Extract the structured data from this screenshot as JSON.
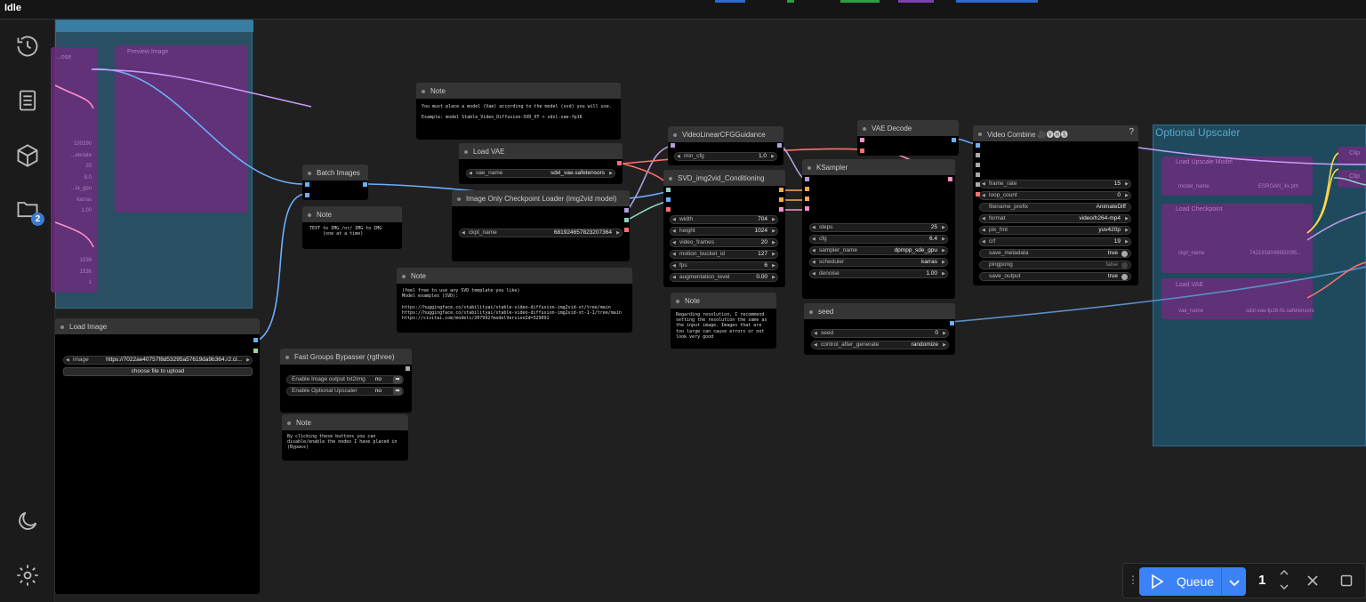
{
  "status": "Idle",
  "sidebar": {
    "queue_badge": "2"
  },
  "groups": {
    "optional_upscaler": "Optional Upscaler"
  },
  "left_group": {
    "preview_title": "Preview Image",
    "title_fragment": "...ose",
    "values": [
      "100290",
      "...elerate",
      "25",
      "8.0",
      "...la_gpu",
      "karras",
      "1.00"
    ],
    "bottom_values": [
      "1536",
      "1536",
      "1"
    ]
  },
  "nodes": {
    "load_image": {
      "title": "Load Image",
      "image_label": "image",
      "image_value": "https://7022ae40757f8d53295a57619da9b364.r2.cl...",
      "upload": "choose file to upload"
    },
    "batch_images": {
      "title": "Batch Images"
    },
    "note_txt2img": {
      "title": "Note",
      "text": "TEXT to IMG /or/ IMG to IMG\n     (one at a time)"
    },
    "fast_groups": {
      "title": "Fast Groups Bypasser (rgthree)",
      "items": [
        {
          "label": "Enable Image output txt2img",
          "value": "no"
        },
        {
          "label": "Enable Optional Upscaler",
          "value": "no"
        }
      ]
    },
    "note_bypass": {
      "title": "Note",
      "text": "By clicking these buttons you can\ndisable/enable the nodes I have placed in\n(Bypass)"
    },
    "note_vae": {
      "title": "Note",
      "text": "You must place a model (Vae) according to the model (svd) you will use.\n\nExample: model Stable_Video_Diffusion-SVD_XT > sdxl-vae-fp16"
    },
    "load_vae": {
      "title": "Load VAE",
      "label": "vae_name",
      "value": "sdxl_vae.safetensors"
    },
    "checkpoint": {
      "title": "Image Only Checkpoint Loader (img2vid model)",
      "label": "ckpt_name",
      "value": "681924657823207364"
    },
    "note_links": {
      "title": "Note",
      "text": "(feel free to use any SVD template you like)\nModel examples (SVD):\n\nhttps://huggingface.co/stabilityai/stable-video-diffusion-img2vid-xt/tree/main\nhttps://huggingface.co/stabilityai/stable-video-diffusion-img2vid-xt-1-1/tree/main\nhttps://civitai.com/models/207992?modelVersionId=329091"
    },
    "vlcfg": {
      "title": "VideoLinearCFGGuidance",
      "label": "min_cfg",
      "value": "1.0"
    },
    "svd_cond": {
      "title": "SVD_img2vid_Conditioning",
      "widgets": [
        {
          "label": "width",
          "value": "704"
        },
        {
          "label": "height",
          "value": "1024"
        },
        {
          "label": "video_frames",
          "value": "20"
        },
        {
          "label": "motion_bucket_id",
          "value": "127"
        },
        {
          "label": "fps",
          "value": "6"
        },
        {
          "label": "augmentation_level",
          "value": "0.00"
        }
      ]
    },
    "note_res": {
      "title": "Note",
      "text": "Regarding resolution, I recommend\nsetting the resolution the same as\nthe input image. Images that are\ntoo large can cause errors or not\nlook very good"
    },
    "vae_decode": {
      "title": "VAE Decode"
    },
    "ksampler": {
      "title": "KSampler",
      "widgets": [
        {
          "label": "steps",
          "value": "25"
        },
        {
          "label": "cfg",
          "value": "6.4"
        },
        {
          "label": "sampler_name",
          "value": "dpmpp_sde_gpu"
        },
        {
          "label": "scheduler",
          "value": "karras"
        },
        {
          "label": "denoise",
          "value": "1.00"
        }
      ]
    },
    "seed": {
      "title": "seed",
      "widgets": [
        {
          "label": "seed",
          "value": "0"
        },
        {
          "label": "control_after_generate",
          "value": "randomize"
        }
      ]
    },
    "video_combine": {
      "title": "Video Combine 🎥🅥🅗🅢",
      "help": "?",
      "widgets": [
        {
          "label": "frame_rate",
          "value": "15"
        },
        {
          "label": "loop_count",
          "value": "0"
        },
        {
          "label": "filename_prefix",
          "value": "AnimateDiff"
        },
        {
          "label": "format",
          "value": "video/h264-mp4"
        },
        {
          "label": "pix_fmt",
          "value": "yuv420p"
        },
        {
          "label": "crf",
          "value": "19"
        }
      ],
      "toggles": [
        {
          "label": "save_metadata",
          "value": "true"
        },
        {
          "label": "pingpong",
          "value": "false"
        },
        {
          "label": "save_output",
          "value": "true"
        }
      ]
    },
    "upscaler": {
      "load_upscale_model": "Load Upscale Model",
      "model_name_label": "model_name",
      "model_name_value": "ESRGAN_4x.pth",
      "load_checkpoint": "Load Checkpoint",
      "ckpt_label": "ckpt_name",
      "ckpt_value": "7421918049850095...",
      "load_vae": "Load VAE",
      "vae_label": "vae_name",
      "vae_value": "sdxl-vae-fp16-fix.safetensors",
      "right_edge_a": "Clip",
      "right_edge_b": "Clip"
    }
  },
  "queue": {
    "button": "Queue",
    "count": "1"
  },
  "colors": {
    "accent": "#3b82f6",
    "group_blue": "#2a5f7a",
    "purple": "#6b2d7a"
  }
}
